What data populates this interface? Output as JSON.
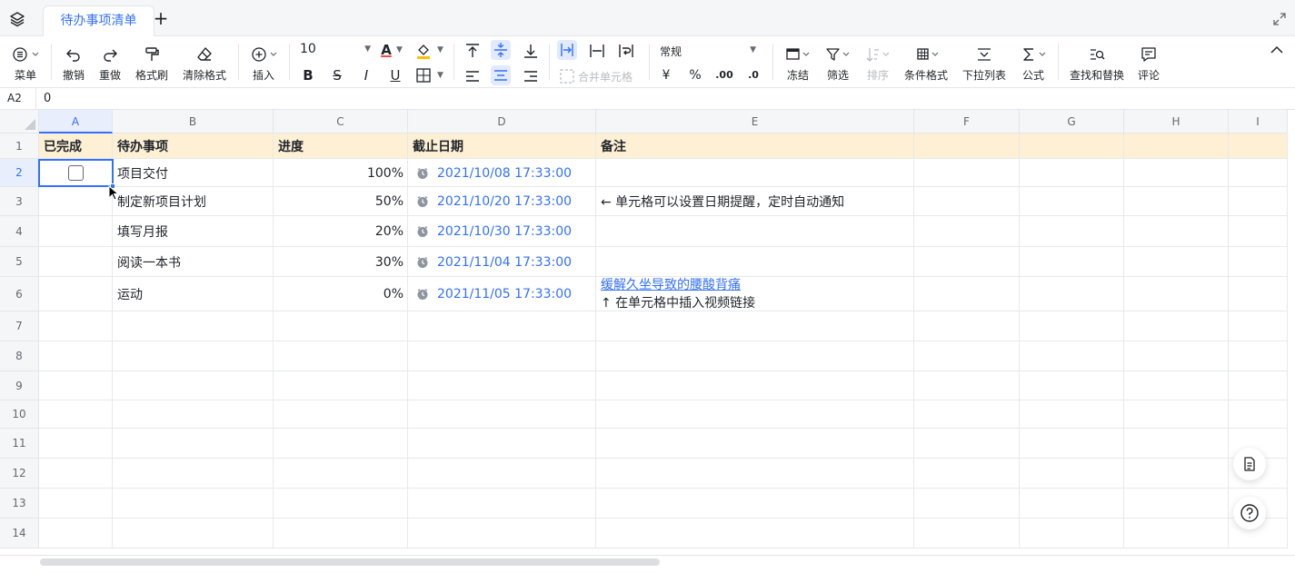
{
  "tabbar": {
    "sheet_tab": "待办事项清单",
    "add": "+"
  },
  "toolbar": {
    "menu": "菜单",
    "undo": "撤销",
    "redo": "重做",
    "format_painter": "格式刷",
    "clear_format": "清除格式",
    "insert": "插入",
    "font_size": "10",
    "merge_cells": "合并单元格",
    "number_format": "常规",
    "currency": "¥",
    "percent": "%",
    "decimal_inc": ".00",
    "decimal_dec": ".0",
    "freeze": "冻结",
    "filter": "筛选",
    "sort": "排序",
    "conditional_format": "条件格式",
    "dropdown_list": "下拉列表",
    "formula": "公式",
    "find_replace": "查找和替换",
    "comment": "评论",
    "bold": "B",
    "strike": "S",
    "italic": "I",
    "underline": "U",
    "font_color": "A"
  },
  "formula_bar": {
    "cell_ref": "A2",
    "value": "0"
  },
  "columns": [
    "A",
    "B",
    "C",
    "D",
    "E",
    "F",
    "G",
    "H",
    "I"
  ],
  "rows": [
    "1",
    "2",
    "3",
    "4",
    "5",
    "6",
    "7",
    "8",
    "9",
    "10",
    "11",
    "12",
    "13",
    "14"
  ],
  "header_row": {
    "a": "已完成",
    "b": "待办事项",
    "c": "进度",
    "d": "截止日期",
    "e": "备注"
  },
  "tasks": [
    {
      "task": "项目交付",
      "progress": "100%",
      "due": "2021/10/08 17:33:00",
      "note": ""
    },
    {
      "task": "制定新项目计划",
      "progress": "50%",
      "due": "2021/10/20 17:33:00",
      "note": "← 单元格可以设置日期提醒，定时自动通知"
    },
    {
      "task": "填写月报",
      "progress": "20%",
      "due": "2021/10/30 17:33:00",
      "note": ""
    },
    {
      "task": "阅读一本书",
      "progress": "30%",
      "due": "2021/11/04 17:33:00",
      "note": ""
    },
    {
      "task": "运动",
      "progress": "0%",
      "due": "2021/11/05 17:33:00",
      "note_link": "缓解久坐导致的腰酸背痛",
      "note": "↑ 在单元格中插入视频链接"
    }
  ],
  "colors": {
    "accent": "#3370ff",
    "header_fill": "#fdf0d5"
  }
}
